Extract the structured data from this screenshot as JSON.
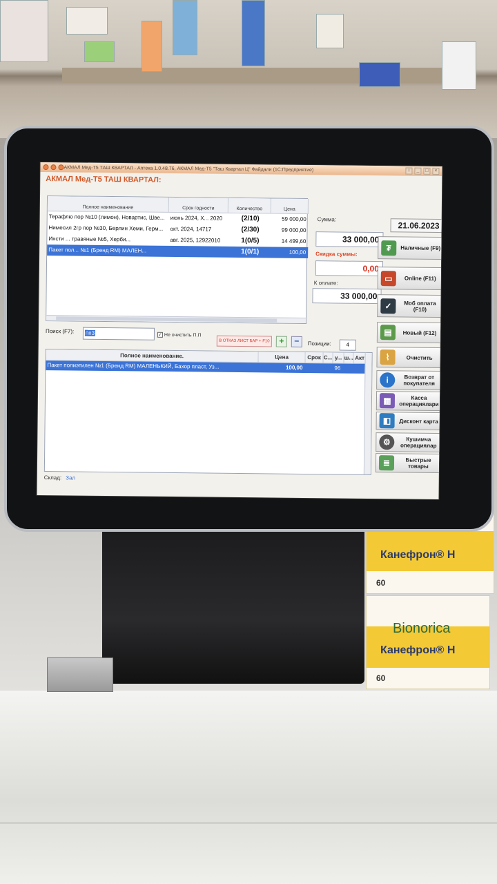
{
  "window": {
    "titlebar_text": "АКМАЛ Мед-Т5 ТАШ КВАРТАЛ - Аптека 1.0.48.76, АКМАЛ Мед-Т5 \"Таш Квартал Ц\" Файдали (1С:Предприятие)",
    "app_title": "АКМАЛ Мед-Т5 ТАШ КВАРТАЛ:"
  },
  "cart_table": {
    "headers": [
      "Полное наименование",
      "Срок годности",
      "Количество",
      "Цена"
    ],
    "rows": [
      {
        "name": "Терафлю пор №10 (лимон), Новартис, Шве...",
        "expiry": "июнь 2024, X... 2020",
        "qty": "(2/10)",
        "price": "59 000,00"
      },
      {
        "name": "Нимесил 2гр пор №30, Берлин Хеми, Герм...",
        "expiry": "окт. 2024, 14717",
        "qty": "(2/30)",
        "price": "99 000,00"
      },
      {
        "name": "Инсти ... травяные №5, Херби...",
        "expiry": "авг. 2025, 12922010",
        "qty": "1(0/5)",
        "price": "14 499,60"
      },
      {
        "name": "Пакет пол... №1 (Бренд RM) МАЛЕН...",
        "expiry": "",
        "qty": "1(0/1)",
        "price": "100,00"
      }
    ]
  },
  "totals": {
    "date": "21.06.2023",
    "sum_label": "Сумма:",
    "sum_value": "33 000,00",
    "discount_label": "Скидка суммы:",
    "discount_value": "0,00",
    "to_pay_label": "К оплате:",
    "to_pay_value": "33 000,00"
  },
  "buttons": {
    "cash": "Наличные (F9)",
    "online": "Online (F11)",
    "mobile": "Моб оплата (F10)",
    "new": "Новый (F12)",
    "clear": "Очистить",
    "return": "Возврат от покупателя",
    "cash_ops": "Касса операциялари",
    "discount_card": "Дисконт карта",
    "other_ops": "Кушимча операциялар",
    "quick_goods": "Быстрые товары"
  },
  "search": {
    "label": "Поиск (F7):",
    "value": "пп3",
    "no_clear_label": "Не очистить П.П",
    "no_clear_checked": "✓",
    "red_button": "В ОТКАЗ ЛИСТ БАР + F10",
    "plus": "+",
    "minus": "−",
    "positions_label": "Позиции:",
    "positions_value": "4"
  },
  "search_table": {
    "headers": [
      "Полное наименование.",
      "Цена",
      "Срок",
      "С...",
      "у...",
      "ш...",
      "Акт"
    ],
    "row": {
      "name": "Пакет полиэтилен №1 (Бренд RM) МАЛЕНЬКИЙ, Бахор пласт, Уз...",
      "price": "100,00",
      "stock": "96"
    }
  },
  "footer": {
    "warehouse_label": "Склад:",
    "warehouse_value": "Зал"
  },
  "scene": {
    "brand": "Bionorica",
    "product": "Канефрон® Н",
    "count": "60"
  },
  "colors": {
    "selection": "#3b73d6",
    "accent_orange": "#d15a2a",
    "discount_red": "#d62b1a"
  }
}
